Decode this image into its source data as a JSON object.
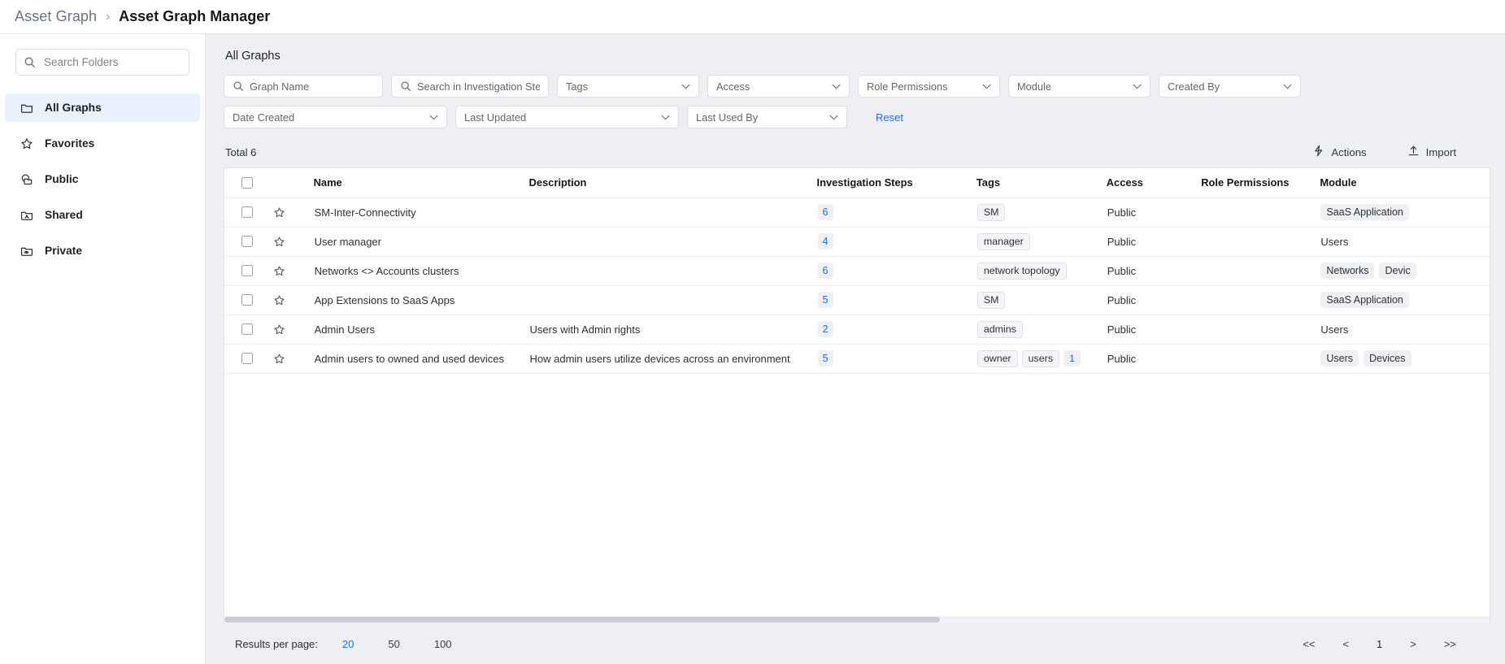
{
  "breadcrumb": {
    "parent": "Asset Graph",
    "separator": "›",
    "current": "Asset Graph Manager"
  },
  "sidebar": {
    "search_placeholder": "Search Folders",
    "search_value": "",
    "items": [
      {
        "label": "All Graphs",
        "icon": "folder-icon",
        "active": true
      },
      {
        "label": "Favorites",
        "icon": "star-icon",
        "active": false
      },
      {
        "label": "Public",
        "icon": "public-folder-icon",
        "active": false
      },
      {
        "label": "Shared",
        "icon": "shared-folder-icon",
        "active": false
      },
      {
        "label": "Private",
        "icon": "private-folder-icon",
        "active": false
      }
    ]
  },
  "main": {
    "section_title": "All Graphs",
    "filters_row1": [
      {
        "label": "Graph Name",
        "type": "search"
      },
      {
        "label": "Search in Investigation Steps",
        "type": "search"
      },
      {
        "label": "Tags",
        "type": "select"
      },
      {
        "label": "Access",
        "type": "select"
      },
      {
        "label": "Role Permissions",
        "type": "select"
      },
      {
        "label": "Module",
        "type": "select"
      },
      {
        "label": "Created By",
        "type": "select"
      }
    ],
    "filters_row2": [
      {
        "label": "Date Created",
        "type": "select"
      },
      {
        "label": "Last Updated",
        "type": "select"
      },
      {
        "label": "Last Used By",
        "type": "select"
      }
    ],
    "reset_label": "Reset",
    "total_label": "Total 6",
    "actions_label": "Actions",
    "import_label": "Import"
  },
  "table": {
    "columns": [
      "Name",
      "Description",
      "Investigation Steps",
      "Tags",
      "Access",
      "Role Permissions",
      "Module"
    ],
    "rows": [
      {
        "name": "SM-Inter-Connectivity",
        "description": "",
        "steps": "6",
        "tags": [
          "SM"
        ],
        "tags_more": "",
        "access": "Public",
        "role_permissions": "",
        "modules": [
          "SaaS Application"
        ],
        "modules_plain": ""
      },
      {
        "name": "User manager",
        "description": "",
        "steps": "4",
        "tags": [
          "manager"
        ],
        "tags_more": "",
        "access": "Public",
        "role_permissions": "",
        "modules": [],
        "modules_plain": "Users"
      },
      {
        "name": "Networks <> Accounts clusters",
        "description": "",
        "steps": "6",
        "tags": [
          "network topology"
        ],
        "tags_more": "",
        "access": "Public",
        "role_permissions": "",
        "modules": [
          "Networks",
          "Devic"
        ],
        "modules_plain": ""
      },
      {
        "name": "App Extensions to SaaS Apps",
        "description": "",
        "steps": "5",
        "tags": [
          "SM"
        ],
        "tags_more": "",
        "access": "Public",
        "role_permissions": "",
        "modules": [
          "SaaS Application"
        ],
        "modules_plain": ""
      },
      {
        "name": "Admin Users",
        "description": "Users with Admin rights",
        "steps": "2",
        "tags": [
          "admins"
        ],
        "tags_more": "",
        "access": "Public",
        "role_permissions": "",
        "modules": [],
        "modules_plain": "Users"
      },
      {
        "name": "Admin users to owned and used devices",
        "description": "How admin users utilize devices across an environment",
        "steps": "5",
        "tags": [
          "owner",
          "users"
        ],
        "tags_more": "1",
        "access": "Public",
        "role_permissions": "",
        "modules": [
          "Users",
          "Devices"
        ],
        "modules_plain": ""
      }
    ]
  },
  "footer": {
    "results_per_page_label": "Results per page:",
    "options": [
      {
        "label": "20",
        "active": true
      },
      {
        "label": "50",
        "active": false
      },
      {
        "label": "100",
        "active": false
      }
    ],
    "pager": [
      {
        "label": "<<",
        "name": "first-page"
      },
      {
        "label": "<",
        "name": "prev-page"
      },
      {
        "label": "1",
        "name": "current-page"
      },
      {
        "label": ">",
        "name": "next-page"
      },
      {
        "label": ">>",
        "name": "last-page"
      }
    ]
  },
  "colors": {
    "accent": "#1a6ef0",
    "active_nav_bg": "#e8f1fd",
    "page_bg": "#edeff3"
  }
}
